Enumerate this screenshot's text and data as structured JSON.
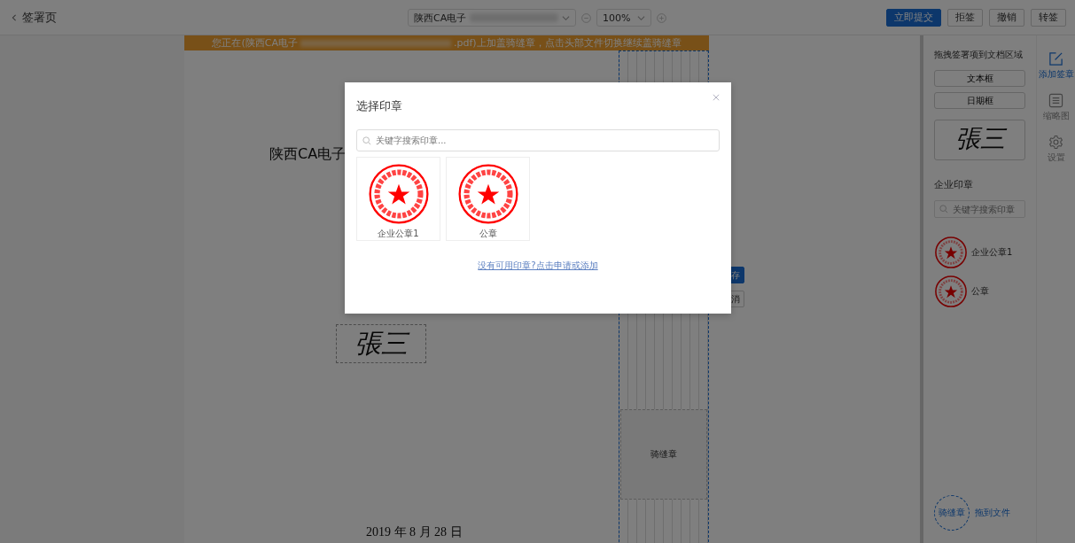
{
  "top_bar": {
    "back": {
      "label": "签署页"
    },
    "document_select": {
      "value": "陕西CA电子"
    },
    "zoom_select": {
      "value": "100%"
    },
    "buttons": [
      {
        "label": "立即提交",
        "kind": "primary"
      },
      {
        "label": "拒签",
        "kind": "default"
      },
      {
        "label": "撤销",
        "kind": "default"
      },
      {
        "label": "转签",
        "kind": "default"
      }
    ]
  },
  "notice": {
    "before": "您正在(陕西CA电子",
    "after": ".pdf)上加盖骑缝章，点击头部文件切换继续盖骑缝章"
  },
  "document": {
    "title": "陕西CA电子",
    "signature": "張三",
    "date": "2019 年 8 月 28 日",
    "covered_buttons": [
      {
        "label": "存",
        "kind": "primary"
      },
      {
        "label": "消",
        "kind": "default"
      }
    ]
  },
  "seam_stamp": {
    "label": "骑缝章"
  },
  "sidebar": {
    "hint": "拖拽签署项到文档区域",
    "fields": [
      "文本框",
      "日期框"
    ],
    "signature": "張三",
    "section": "企业印章",
    "search": {
      "placeholder": "关键字搜索印章"
    },
    "seals": [
      {
        "name": "企业公章1"
      },
      {
        "name": "公章"
      }
    ],
    "seam": {
      "badge": "骑缝章",
      "hint": "拖到文件"
    }
  },
  "tabs": [
    {
      "label": "添加签章",
      "kind": "edit",
      "selected": true
    },
    {
      "label": "缩略图",
      "kind": "list",
      "selected": false
    },
    {
      "label": "设置",
      "kind": "gear",
      "selected": false
    }
  ],
  "modal": {
    "title": "选择印章",
    "search": {
      "placeholder": "关键字搜索印章..."
    },
    "seals": [
      {
        "name": "企业公章1"
      },
      {
        "name": "公章"
      }
    ],
    "link": "没有可用印章?点击申请或添加"
  }
}
